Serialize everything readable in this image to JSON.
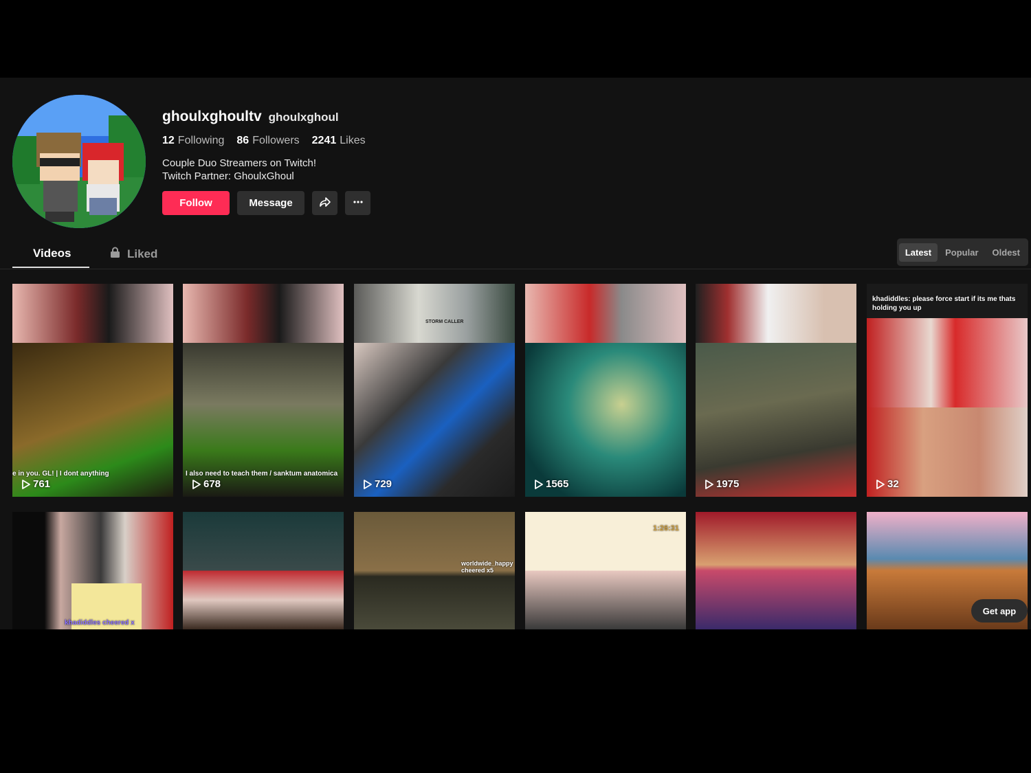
{
  "profile": {
    "display_name": "ghoulxghoultv",
    "handle": "ghoulxghoul",
    "following_count": "12",
    "following_label": "Following",
    "followers_count": "86",
    "followers_label": "Followers",
    "likes_count": "2241",
    "likes_label": "Likes",
    "bio_line1": "Couple Duo Streamers on Twitch!",
    "bio_line2": "Twitch Partner: GhoulxGhoul"
  },
  "actions": {
    "follow": "Follow",
    "message": "Message",
    "share_icon": "share-icon",
    "more_icon": "more-icon"
  },
  "tabs": {
    "videos": "Videos",
    "liked": "Liked"
  },
  "sort": {
    "latest": "Latest",
    "popular": "Popular",
    "oldest": "Oldest",
    "active": "Latest"
  },
  "videos_row1": [
    {
      "views": "761",
      "overlay": "e in you. GL! | I dont anything"
    },
    {
      "views": "678",
      "overlay": "I also need to teach them / sanktum anatomica"
    },
    {
      "views": "729",
      "overlay": "STORM CALLER"
    },
    {
      "views": "1565",
      "overlay": ""
    },
    {
      "views": "1975",
      "overlay": ""
    },
    {
      "views": "32",
      "overlay": "khadiddles: please force start if its me thats holding you up"
    }
  ],
  "videos_row2": [
    {
      "overlay": "khadiddles cheered x"
    },
    {
      "overlay": ""
    },
    {
      "overlay": "worldwide_happy cheered x5"
    },
    {
      "overlay": "1:26:31"
    },
    {
      "overlay": ""
    },
    {
      "overlay": ""
    }
  ],
  "get_app": "Get app",
  "colors": {
    "accent": "#fe2c55",
    "background": "#121212",
    "button": "#2f2f2f"
  }
}
